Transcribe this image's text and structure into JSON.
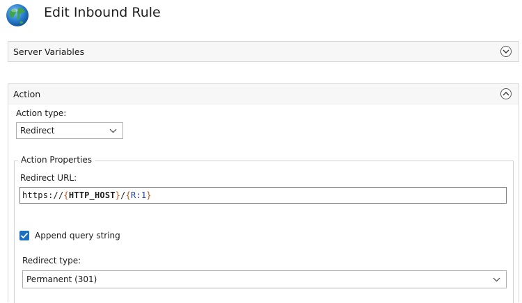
{
  "header": {
    "title": "Edit Inbound Rule",
    "icon": "globe-icon"
  },
  "server_variables": {
    "label": "Server Variables",
    "state": "collapsed"
  },
  "action": {
    "label": "Action",
    "state": "expanded",
    "action_type_label": "Action type:",
    "action_type_value": "Redirect",
    "properties": {
      "legend": "Action Properties",
      "redirect_url_label": "Redirect URL:",
      "redirect_url_parts": {
        "p1": "https://",
        "p2": "{",
        "p3": "HTTP_HOST",
        "p4": "}",
        "p5": "/",
        "p6": "{",
        "p7": "R:1",
        "p8": "}"
      },
      "append_query_label": "Append query string",
      "append_query_checked": true,
      "redirect_type_label": "Redirect type:",
      "redirect_type_value": "Permanent (301)"
    }
  },
  "colors": {
    "accent": "#1a6fc0",
    "panel_bg": "#f7f7f7",
    "border": "#d9d9d9",
    "url_brace": "#b5561d",
    "url_variable": "#1f3fa8"
  }
}
